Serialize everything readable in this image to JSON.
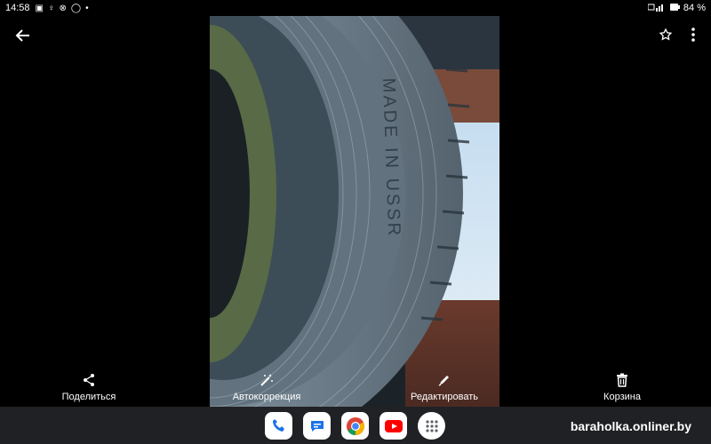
{
  "status_bar": {
    "time": "14:58",
    "battery": "84 %",
    "left_icons": [
      "android-icon",
      "accessibility-icon",
      "settings-icon",
      "bubble-icon",
      "dot-icon"
    ],
    "right_icons": [
      "signal-icon",
      "wifi-icon",
      "battery-icon"
    ]
  },
  "toolbar": {
    "back_icon": "arrow-left-icon",
    "favorite_icon": "star-outline-icon",
    "more_icon": "more-vert-icon"
  },
  "photo": {
    "tire_text": "MADE IN USSR"
  },
  "actions": [
    {
      "label": "Поделиться",
      "icon": "share-icon"
    },
    {
      "label": "Автокоррекция",
      "icon": "auto-fix-icon"
    },
    {
      "label": "Редактировать",
      "icon": "edit-icon"
    },
    {
      "label": "Корзина",
      "icon": "trash-icon"
    }
  ],
  "taskbar": {
    "apps": [
      "Phone",
      "Messages",
      "Chrome",
      "YouTube",
      "Apps"
    ],
    "watermark": "baraholka.onliner.by"
  },
  "colors": {
    "background": "#000000",
    "taskbar": "#202124",
    "text": "#ffffff"
  }
}
